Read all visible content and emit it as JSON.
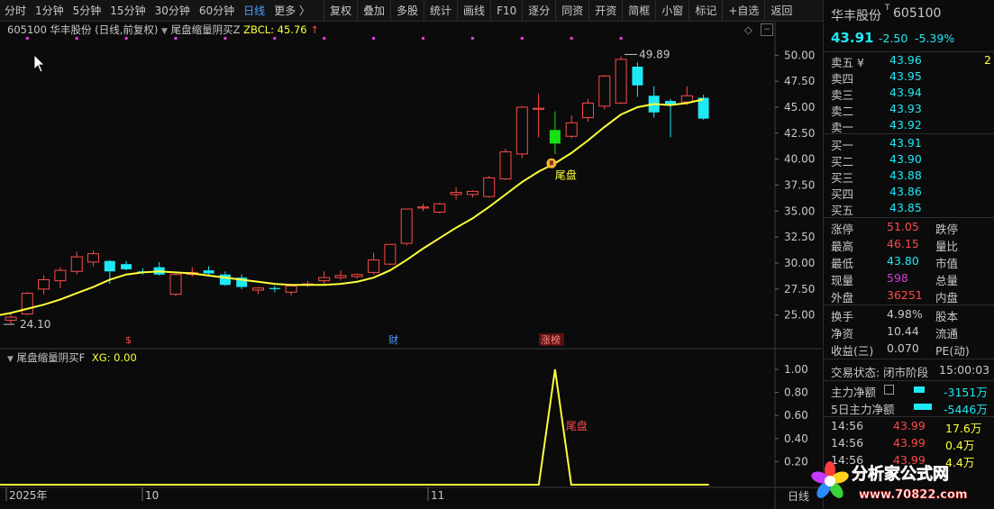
{
  "toolbar": {
    "periods": [
      "分时",
      "1分钟",
      "5分钟",
      "15分钟",
      "30分钟",
      "60分钟",
      "日线",
      "更多 〉"
    ],
    "active_period": "日线",
    "buttons": [
      "复权",
      "叠加",
      "多股",
      "统计",
      "画线",
      "F10",
      "逐分",
      "同资",
      "开资",
      "简框",
      "小窗",
      "标记",
      "+自选",
      "返回"
    ]
  },
  "chart": {
    "title": "605100 华丰股份 (日线,前复权)",
    "indicator_name": "尾盘缩量阴买Z",
    "zbcl_label": "ZBCL: 45.76",
    "high_label": "49.89",
    "low_label": "24.10",
    "signal_label": "尾盘",
    "markers": [
      "$",
      "财",
      "涨榜"
    ],
    "price_axis": [
      "50.00",
      "47.50",
      "45.00",
      "42.50",
      "40.00",
      "37.50",
      "35.00",
      "32.50",
      "30.00",
      "27.50",
      "25.00"
    ],
    "sub_title": "尾盘缩量阴买F",
    "xg_label": "XG: 0.00",
    "sub_axis": [
      "1.00",
      "0.80",
      "0.60",
      "0.40",
      "0.20"
    ],
    "sub_signal_label": "尾盘",
    "date_labels": [
      "2025年",
      "10",
      "11"
    ],
    "corner_label": "日线"
  },
  "colors": {
    "up": "#ff4a4a",
    "down": "#1fe8f5",
    "ma": "#ffff3a",
    "signal": "#16e016",
    "bg": "#0b0b0b",
    "grid": "#3a3a3a"
  },
  "chart_data": {
    "type": "candlestick",
    "ylim": [
      23.5,
      51.5
    ],
    "candles": [
      {
        "o": 24.5,
        "h": 25.1,
        "l": 24.1,
        "c": 24.8
      },
      {
        "o": 25.1,
        "h": 27.2,
        "l": 25.0,
        "c": 27.1
      },
      {
        "o": 27.5,
        "h": 28.8,
        "l": 27.0,
        "c": 28.4
      },
      {
        "o": 28.3,
        "h": 29.6,
        "l": 27.6,
        "c": 29.3
      },
      {
        "o": 29.2,
        "h": 31.1,
        "l": 28.9,
        "c": 30.6
      },
      {
        "o": 30.1,
        "h": 31.2,
        "l": 29.7,
        "c": 30.9
      },
      {
        "o": 30.2,
        "h": 30.3,
        "l": 28.0,
        "c": 29.2
      },
      {
        "o": 29.9,
        "h": 30.2,
        "l": 29.3,
        "c": 29.4
      },
      {
        "o": 29.2,
        "h": 29.5,
        "l": 28.9,
        "c": 29.1
      },
      {
        "o": 29.6,
        "h": 30.1,
        "l": 28.8,
        "c": 28.9
      },
      {
        "o": 27.0,
        "h": 29.0,
        "l": 26.8,
        "c": 28.9
      },
      {
        "o": 28.9,
        "h": 29.6,
        "l": 28.7,
        "c": 29.1
      },
      {
        "o": 29.3,
        "h": 29.7,
        "l": 28.8,
        "c": 29.0
      },
      {
        "o": 28.9,
        "h": 29.2,
        "l": 27.8,
        "c": 27.9
      },
      {
        "o": 28.6,
        "h": 28.9,
        "l": 27.5,
        "c": 27.7
      },
      {
        "o": 27.4,
        "h": 27.7,
        "l": 27.0,
        "c": 27.6
      },
      {
        "o": 27.6,
        "h": 27.8,
        "l": 27.2,
        "c": 27.5
      },
      {
        "o": 27.2,
        "h": 27.9,
        "l": 26.9,
        "c": 27.8
      },
      {
        "o": 27.9,
        "h": 28.3,
        "l": 27.7,
        "c": 28.0
      },
      {
        "o": 28.3,
        "h": 29.2,
        "l": 28.0,
        "c": 28.6
      },
      {
        "o": 28.6,
        "h": 29.3,
        "l": 28.4,
        "c": 28.8
      },
      {
        "o": 28.7,
        "h": 29.0,
        "l": 28.5,
        "c": 28.9
      },
      {
        "o": 29.1,
        "h": 31.0,
        "l": 28.9,
        "c": 30.3
      },
      {
        "o": 29.9,
        "h": 31.8,
        "l": 29.8,
        "c": 31.8
      },
      {
        "o": 31.9,
        "h": 35.2,
        "l": 31.7,
        "c": 35.2
      },
      {
        "o": 35.3,
        "h": 35.7,
        "l": 35.0,
        "c": 35.4
      },
      {
        "o": 34.9,
        "h": 35.8,
        "l": 34.8,
        "c": 35.7
      },
      {
        "o": 36.6,
        "h": 37.3,
        "l": 36.1,
        "c": 36.8
      },
      {
        "o": 36.6,
        "h": 37.0,
        "l": 36.3,
        "c": 36.9
      },
      {
        "o": 36.4,
        "h": 38.4,
        "l": 36.3,
        "c": 38.2
      },
      {
        "o": 38.1,
        "h": 41.0,
        "l": 38.0,
        "c": 40.7
      },
      {
        "o": 40.5,
        "h": 45.1,
        "l": 40.1,
        "c": 45.0
      },
      {
        "o": 44.9,
        "h": 46.3,
        "l": 42.1,
        "c": 44.9
      },
      {
        "o": 41.5,
        "h": 44.6,
        "l": 40.5,
        "c": 42.8
      },
      {
        "o": 42.2,
        "h": 44.2,
        "l": 42.0,
        "c": 43.5
      },
      {
        "o": 44.0,
        "h": 45.8,
        "l": 43.6,
        "c": 45.4
      },
      {
        "o": 45.1,
        "h": 48.1,
        "l": 44.8,
        "c": 48.0
      },
      {
        "o": 45.4,
        "h": 49.9,
        "l": 45.3,
        "c": 49.6
      },
      {
        "o": 48.9,
        "h": 49.3,
        "l": 46.0,
        "c": 47.1
      },
      {
        "o": 46.1,
        "h": 47.0,
        "l": 44.0,
        "c": 44.5
      },
      {
        "o": 45.6,
        "h": 45.8,
        "l": 42.1,
        "c": 45.3
      },
      {
        "o": 45.5,
        "h": 47.0,
        "l": 45.2,
        "c": 46.1
      },
      {
        "o": 45.9,
        "h": 46.2,
        "l": 43.8,
        "c": 43.9
      }
    ],
    "signal_index": 33,
    "ma": [
      25.2,
      25.6,
      26.0,
      26.5,
      27.1,
      27.7,
      28.4,
      28.9,
      29.1,
      29.2,
      29.1,
      29.0,
      28.8,
      28.6,
      28.4,
      28.2,
      28.0,
      27.9,
      27.9,
      27.9,
      28.0,
      28.2,
      28.6,
      29.3,
      30.3,
      31.4,
      32.4,
      33.4,
      34.3,
      35.4,
      36.6,
      37.8,
      38.8,
      39.6,
      40.6,
      41.8,
      43.1,
      44.3,
      45.0,
      45.3,
      45.2,
      45.4,
      45.76
    ],
    "sub_signal": {
      "index": 33,
      "value": 1.0
    }
  },
  "quote": {
    "name": "华丰股份",
    "tag": "T",
    "code": "605100",
    "price": "43.91",
    "change": "-2.50",
    "change_pct": "-5.39%",
    "asks": [
      {
        "label": "卖五 ¥",
        "price": "43.96",
        "vol": "2"
      },
      {
        "label": "卖四",
        "price": "43.95",
        "vol": ""
      },
      {
        "label": "卖三",
        "price": "43.94",
        "vol": ""
      },
      {
        "label": "卖二",
        "price": "43.93",
        "vol": ""
      },
      {
        "label": "卖一",
        "price": "43.92",
        "vol": ""
      }
    ],
    "bids": [
      {
        "label": "买一",
        "price": "43.91"
      },
      {
        "label": "买二",
        "price": "43.90"
      },
      {
        "label": "买三",
        "price": "43.88"
      },
      {
        "label": "买四",
        "price": "43.86"
      },
      {
        "label": "买五",
        "price": "43.85"
      }
    ],
    "stats": [
      {
        "l1": "涨停",
        "v1": "51.05",
        "l2": "跌停"
      },
      {
        "l1": "最高",
        "v1": "46.15",
        "l2": "量比"
      },
      {
        "l1": "最低",
        "v1": "43.80",
        "l2": "市值"
      },
      {
        "l1": "现量",
        "v1": "598",
        "l2": "总量"
      },
      {
        "l1": "外盘",
        "v1": "36251",
        "l2": "内盘"
      }
    ],
    "stats2": [
      {
        "l1": "换手",
        "v1": "4.98%",
        "l2": "股本"
      },
      {
        "l1": "净资",
        "v1": "10.44",
        "l2": "流通"
      },
      {
        "l1": "收益(三)",
        "v1": "0.070",
        "l2": "PE(动)"
      }
    ],
    "status_label": "交易状态: 闭市阶段",
    "status_time": "15:00:03",
    "main_net_label": "主力净额",
    "main_net_value": "-3151万",
    "five_day_label": "5日主力净额",
    "five_day_value": "-5446万",
    "ticks": [
      {
        "time": "14:56",
        "price": "43.99",
        "vol": "17.6万"
      },
      {
        "time": "14:56",
        "price": "43.99",
        "vol": "0.4万"
      },
      {
        "time": "14:56",
        "price": "43.99",
        "vol": "4.4万"
      }
    ]
  },
  "watermark": {
    "title": "分析家公式网",
    "url": "www.70822.com"
  }
}
